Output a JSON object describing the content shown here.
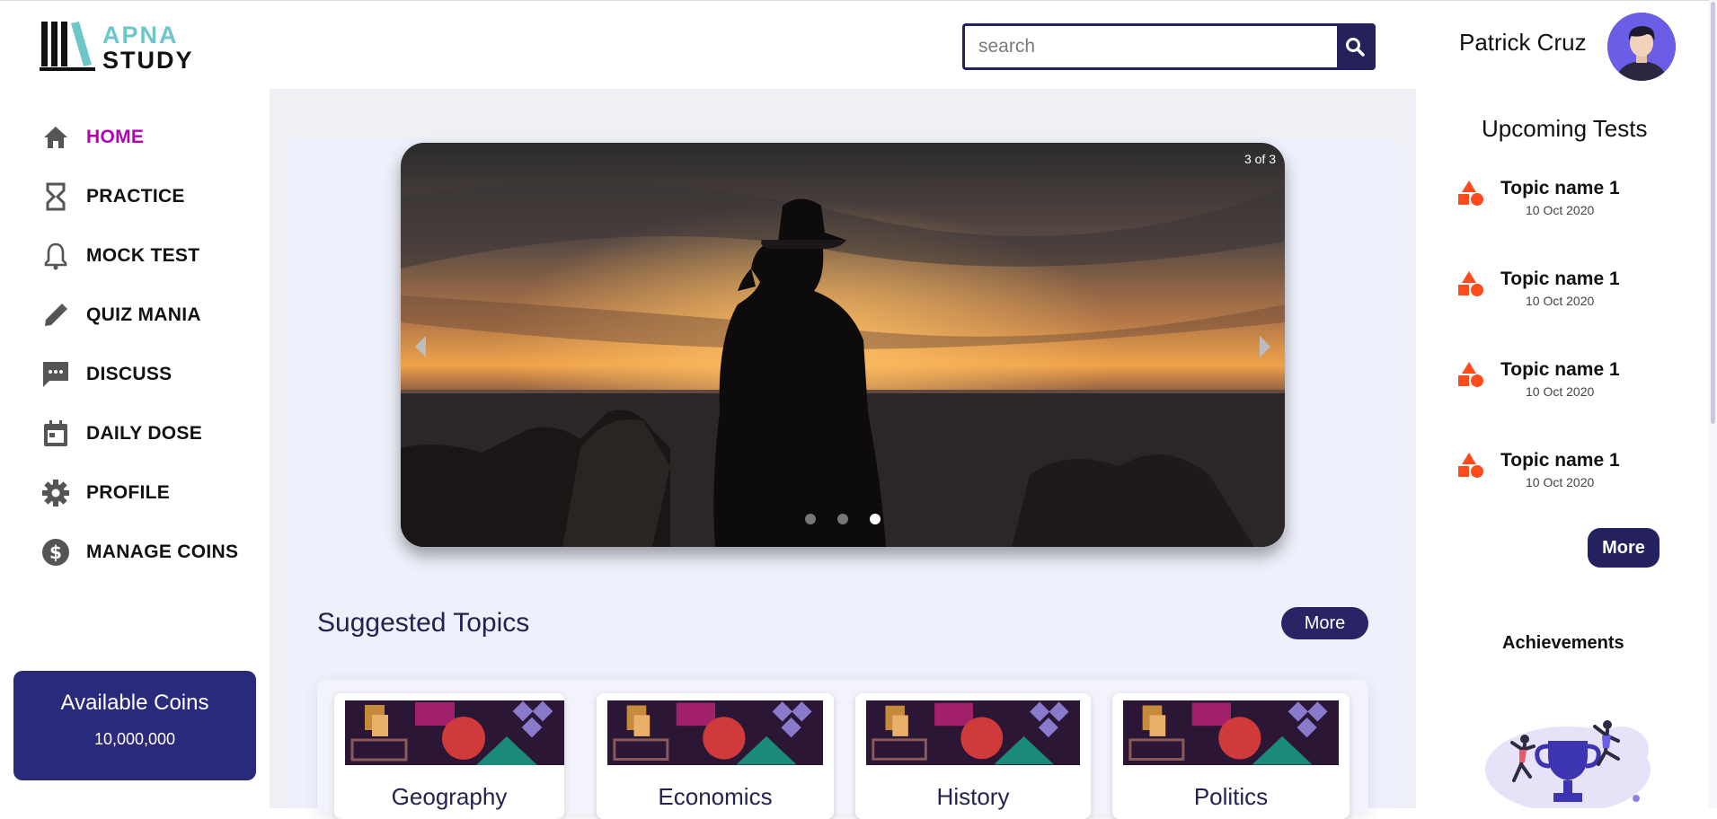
{
  "brand": {
    "line1": "APNA",
    "line2": "STUDY"
  },
  "search": {
    "placeholder": "search"
  },
  "user": {
    "name": "Patrick Cruz"
  },
  "sidebar": {
    "items": [
      {
        "label": "HOME",
        "icon": "home-icon",
        "active": true
      },
      {
        "label": "PRACTICE",
        "icon": "hourglass-icon"
      },
      {
        "label": "MOCK TEST",
        "icon": "bell-icon"
      },
      {
        "label": "QUIZ MANIA",
        "icon": "pencil-icon"
      },
      {
        "label": "DISCUSS",
        "icon": "chat-icon"
      },
      {
        "label": "DAILY DOSE",
        "icon": "calendar-icon"
      },
      {
        "label": "PROFILE",
        "icon": "gear-icon"
      },
      {
        "label": "MANAGE COINS",
        "icon": "dollar-icon"
      }
    ],
    "coins": {
      "title": "Available Coins",
      "value": "10,000,000"
    }
  },
  "carousel": {
    "counter": "3 of 3",
    "slides": 3,
    "active_slide": 3
  },
  "suggested": {
    "title": "Suggested Topics",
    "more_label": "More",
    "topics": [
      "Geography",
      "Economics",
      "History",
      "Politics"
    ]
  },
  "upcoming": {
    "title": "Upcoming Tests",
    "tests": [
      {
        "name": "Topic name 1",
        "date": "10 Oct 2020"
      },
      {
        "name": "Topic name 1",
        "date": "10 Oct 2020"
      },
      {
        "name": "Topic name 1",
        "date": "10 Oct 2020"
      },
      {
        "name": "Topic name 1",
        "date": "10 Oct 2020"
      }
    ],
    "more_label": "More"
  },
  "achievements": {
    "title": "Achievements"
  },
  "colors": {
    "accent": "#b400b4",
    "navy": "#2a2a7c",
    "brand_teal": "#6ec6c9",
    "test_icon": "#ff4a1c"
  }
}
